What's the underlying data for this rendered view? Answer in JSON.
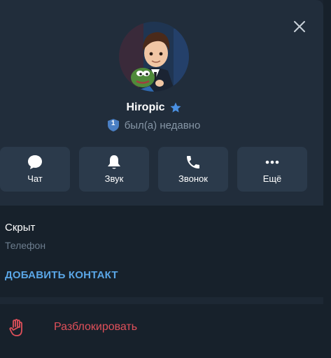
{
  "profile": {
    "name": "Hiropic",
    "status": "был(а) недавно",
    "badge_number": "1"
  },
  "actions": [
    {
      "label": "Чат",
      "icon": "chat-bubble-icon"
    },
    {
      "label": "Звук",
      "icon": "bell-icon"
    },
    {
      "label": "Звонок",
      "icon": "phone-icon"
    },
    {
      "label": "Ещё",
      "icon": "more-dots-icon"
    }
  ],
  "info": {
    "phone_value": "Скрыт",
    "phone_caption": "Телефон",
    "add_contact_label": "ДОБАВИТЬ КОНТАКТ"
  },
  "unblock": {
    "label": "Разблокировать"
  },
  "colors": {
    "panel_bg": "#212d3b",
    "button_bg": "#2b3a4b",
    "accent_blue": "#5aa6e6",
    "star_blue": "#4a90e2",
    "danger_red": "#e0505a"
  }
}
